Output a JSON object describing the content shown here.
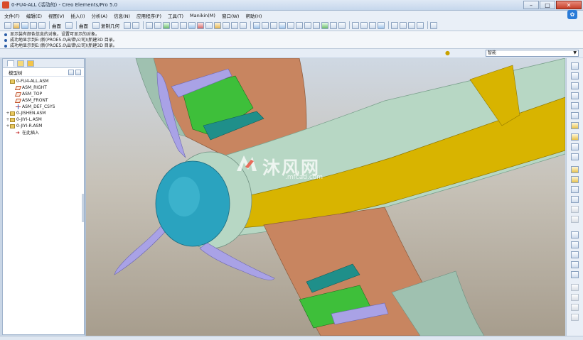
{
  "window": {
    "title": "0-FU4-ALL (活动的) - Creo Elements/Pro 5.0",
    "controls": [
      "minimize",
      "maximize",
      "close"
    ]
  },
  "menu": [
    "文件(F)",
    "编辑(E)",
    "视图(V)",
    "插入(I)",
    "分析(A)",
    "信息(N)",
    "应用程序(P)",
    "工具(T)",
    "Manikin(M)",
    "窗口(W)",
    "帮助(H)"
  ],
  "toolbar": {
    "item_label": "曲面",
    "surface_label": "曲面",
    "copy_label": "复制几何"
  },
  "messages": [
    "显示装有颜色信息的对象。设置可显示的对象。",
    "成功地显示到E:\\新(PROE5.0\\出错\\公司)\\新建3D 目录。",
    "成功地显示到E:\\新(PROE5.0\\出错\\公司)\\新建3D 目录。"
  ],
  "filter": {
    "selected": "智能"
  },
  "model_tree": {
    "header": "模型树",
    "items": [
      {
        "label": "0-FU4-ALL.ASM",
        "icon": "assembly-icon",
        "expand": "",
        "indent": 0
      },
      {
        "label": "ASM_RIGHT",
        "icon": "datum-plane-icon",
        "expand": "",
        "indent": 1
      },
      {
        "label": "ASM_TOP",
        "icon": "datum-plane-icon",
        "expand": "",
        "indent": 1
      },
      {
        "label": "ASM_FRONT",
        "icon": "datum-plane-icon",
        "expand": "",
        "indent": 1
      },
      {
        "label": "ASM_DEF_CSYS",
        "icon": "csys-icon",
        "expand": "",
        "indent": 1
      },
      {
        "label": "0-JISHEN.ASM",
        "icon": "assembly-icon",
        "expand": "+",
        "indent": 0
      },
      {
        "label": "0-JIYI-L.ASM",
        "icon": "assembly-icon",
        "expand": "+",
        "indent": 0
      },
      {
        "label": "0-JIYI-R.ASM",
        "icon": "assembly-icon",
        "expand": "+",
        "indent": 0
      },
      {
        "label": "在此插入",
        "icon": "insert-here-icon",
        "expand": "",
        "indent": 1
      }
    ]
  },
  "watermark": {
    "text": "沐风网",
    "sub": ".mfcad.com"
  },
  "colors": {
    "fuselage": "#b7d7c4",
    "yellow_panel": "#d8b400",
    "wing_copper": "#c88560",
    "spinner": "#2aa3bf",
    "propeller": "#a9a2e6",
    "gear_green": "#3ebf3a",
    "gear_teal": "#1f8f8a"
  }
}
